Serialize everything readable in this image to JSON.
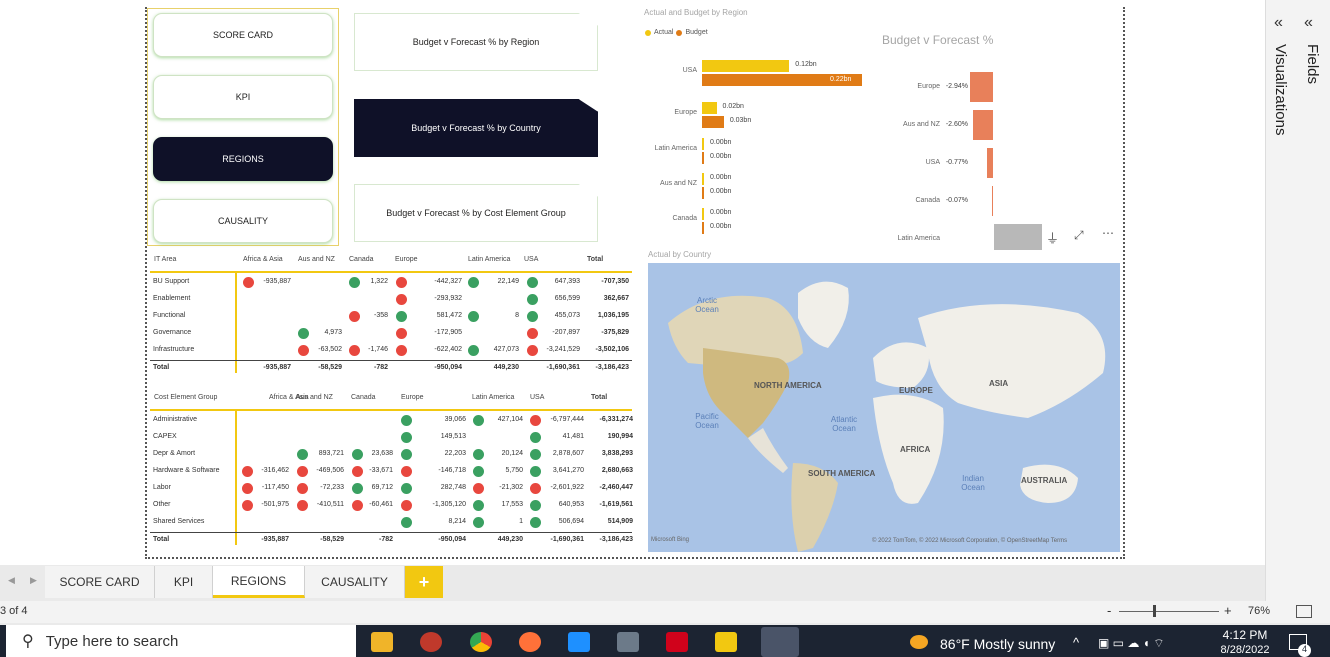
{
  "nav": {
    "buttons": [
      "SCORE CARD",
      "KPI",
      "REGIONS",
      "CAUSALITY"
    ],
    "active": "REGIONS"
  },
  "pages": {
    "buttons": [
      "Budget v Forecast % by Region",
      "Budget v Forecast % by Country",
      "Budget v Forecast % by Cost Element Group"
    ]
  },
  "bar_chart": {
    "title": "Actual and Budget by Region",
    "legend": [
      "Actual",
      "Budget"
    ],
    "colors": {
      "actual": "#f2c811",
      "budget": "#e07b16"
    }
  },
  "pct_chart": {
    "title": "Budget v Forecast %",
    "color": "#e8805a"
  },
  "map": {
    "title": "Actual by Country",
    "labels": {
      "arctic": "Arctic Ocean",
      "north_america": "NORTH AMERICA",
      "europe": "EUROPE",
      "asia": "ASIA",
      "pacific": "Pacific Ocean",
      "atlantic": "Atlantic Ocean",
      "africa": "AFRICA",
      "south_america": "SOUTH AMERICA",
      "indian": "Indian Ocean",
      "australia": "AUSTRALIA"
    },
    "bing": "Microsoft Bing",
    "credits": "© 2022 TomTom, © 2022 Microsoft Corporation, © OpenStreetMap  Terms"
  },
  "chart_data": [
    {
      "type": "bar",
      "title": "Actual and Budget by Region",
      "categories": [
        "USA",
        "Europe",
        "Latin America",
        "Aus and NZ",
        "Canada"
      ],
      "series": [
        {
          "name": "Actual",
          "values": [
            0.12,
            0.02,
            0.0,
            0.0,
            0.0
          ],
          "labels": [
            "0.12bn",
            "0.02bn",
            "0.00bn",
            "0.00bn",
            "0.00bn"
          ]
        },
        {
          "name": "Budget",
          "values": [
            0.22,
            0.03,
            0.0,
            0.0,
            0.0
          ],
          "labels": [
            "0.22bn",
            "0.03bn",
            "0.00bn",
            "0.00bn",
            "0.00bn"
          ]
        }
      ],
      "legend": "top-left"
    },
    {
      "type": "bar",
      "title": "Budget v Forecast %",
      "categories": [
        "Europe",
        "Aus and NZ",
        "USA",
        "Canada",
        "Latin America"
      ],
      "values": [
        -2.94,
        -2.6,
        -0.77,
        -0.07,
        0
      ],
      "labels": [
        "-2.94%",
        "-2.60%",
        "-0.77%",
        "-0.07%",
        ""
      ]
    },
    {
      "type": "table",
      "title": "IT Area",
      "columns": [
        "IT Area",
        "Africa & Asia",
        "Aus and NZ",
        "Canada",
        "Europe",
        "Latin America",
        "USA",
        "Total"
      ],
      "rows": [
        [
          "BU Support",
          "-935,887",
          "",
          "1,322",
          "-442,327",
          "22,149",
          "647,393",
          "-707,350"
        ],
        [
          "Enablement",
          "",
          "",
          "",
          "-293,932",
          "",
          "656,599",
          "362,667"
        ],
        [
          "Functional",
          "",
          "",
          "-358",
          "581,472",
          "8",
          "455,073",
          "1,036,195"
        ],
        [
          "Governance",
          "",
          "4,973",
          "",
          "-172,905",
          "",
          "-207,897",
          "-375,829"
        ],
        [
          "Infrastructure",
          "",
          "-63,502",
          "-1,746",
          "-622,402",
          "427,073",
          "-3,241,529",
          "-3,502,106"
        ],
        [
          "Total",
          "-935,887",
          "-58,529",
          "-782",
          "-950,094",
          "449,230",
          "-1,690,361",
          "-3,186,423"
        ]
      ]
    },
    {
      "type": "table",
      "title": "Cost Element Group",
      "columns": [
        "Cost Element Group",
        "Africa & Asia",
        "Aus and NZ",
        "Canada",
        "Europe",
        "Latin America",
        "USA",
        "Total"
      ],
      "rows": [
        [
          "Administrative",
          "",
          "",
          "",
          "39,066",
          "427,104",
          "-6,797,444",
          "-6,331,274"
        ],
        [
          "CAPEX",
          "",
          "",
          "",
          "149,513",
          "",
          "41,481",
          "190,994"
        ],
        [
          "Depr & Amort",
          "",
          "893,721",
          "23,638",
          "22,203",
          "20,124",
          "2,878,607",
          "3,838,293"
        ],
        [
          "Hardware & Software",
          "-316,462",
          "-469,506",
          "-33,671",
          "-146,718",
          "5,750",
          "3,641,270",
          "2,680,663"
        ],
        [
          "Labor",
          "-117,450",
          "-72,233",
          "69,712",
          "282,748",
          "-21,302",
          "-2,601,922",
          "-2,460,447"
        ],
        [
          "Other",
          "-501,975",
          "-410,511",
          "-60,461",
          "-1,305,120",
          "17,553",
          "640,953",
          "-1,619,561"
        ],
        [
          "Shared Services",
          "",
          "",
          "",
          "8,214",
          "1",
          "506,694",
          "514,909"
        ],
        [
          "Total",
          "-935,887",
          "-58,529",
          "-782",
          "-950,094",
          "449,230",
          "-1,690,361",
          "-3,186,423"
        ]
      ]
    }
  ],
  "it_table": {
    "headers": [
      "IT Area",
      "Africa & Asia",
      "Aus and NZ",
      "Canada",
      "Europe",
      "Latin America",
      "USA",
      "Total"
    ],
    "rows": [
      {
        "name": "BU Support",
        "cells": [
          "-935,887",
          "",
          "1,322",
          "-442,327",
          "22,149",
          "647,393",
          "-707,350"
        ],
        "dots": [
          "r",
          "",
          "g",
          "r",
          "g",
          "g",
          ""
        ]
      },
      {
        "name": "Enablement",
        "cells": [
          "",
          "",
          "",
          "-293,932",
          "",
          "656,599",
          "362,667"
        ],
        "dots": [
          "",
          "",
          "",
          "r",
          "",
          "g",
          ""
        ]
      },
      {
        "name": "Functional",
        "cells": [
          "",
          "",
          "-358",
          "581,472",
          "8",
          "455,073",
          "1,036,195"
        ],
        "dots": [
          "",
          "",
          "r",
          "g",
          "g",
          "g",
          ""
        ]
      },
      {
        "name": "Governance",
        "cells": [
          "",
          "4,973",
          "",
          "-172,905",
          "",
          "-207,897",
          "-375,829"
        ],
        "dots": [
          "",
          "g",
          "",
          "r",
          "",
          "r",
          ""
        ]
      },
      {
        "name": "Infrastructure",
        "cells": [
          "",
          "-63,502",
          "-1,746",
          "-622,402",
          "427,073",
          "-3,241,529",
          "-3,502,106"
        ],
        "dots": [
          "",
          "r",
          "r",
          "r",
          "g",
          "r",
          ""
        ]
      },
      {
        "name": "Total",
        "cells": [
          "-935,887",
          "-58,529",
          "-782",
          "-950,094",
          "449,230",
          "-1,690,361",
          "-3,186,423"
        ],
        "dots": [
          "",
          "",
          "",
          "",
          "",
          "",
          ""
        ]
      }
    ]
  },
  "ce_table": {
    "headers": [
      "Cost Element Group",
      "Africa & Asia",
      "Aus and NZ",
      "Canada",
      "Europe",
      "Latin America",
      "USA",
      "Total"
    ],
    "rows": [
      {
        "name": "Administrative",
        "cells": [
          "",
          "",
          "",
          "39,066",
          "427,104",
          "-6,797,444",
          "-6,331,274"
        ],
        "dots": [
          "",
          "",
          "",
          "g",
          "g",
          "r",
          ""
        ]
      },
      {
        "name": "CAPEX",
        "cells": [
          "",
          "",
          "",
          "149,513",
          "",
          "41,481",
          "190,994"
        ],
        "dots": [
          "",
          "",
          "",
          "g",
          "",
          "g",
          ""
        ]
      },
      {
        "name": "Depr & Amort",
        "cells": [
          "",
          "893,721",
          "23,638",
          "22,203",
          "20,124",
          "2,878,607",
          "3,838,293"
        ],
        "dots": [
          "",
          "g",
          "g",
          "g",
          "g",
          "g",
          ""
        ]
      },
      {
        "name": "Hardware & Software",
        "cells": [
          "-316,462",
          "-469,506",
          "-33,671",
          "-146,718",
          "5,750",
          "3,641,270",
          "2,680,663"
        ],
        "dots": [
          "r",
          "r",
          "r",
          "r",
          "g",
          "g",
          ""
        ]
      },
      {
        "name": "Labor",
        "cells": [
          "-117,450",
          "-72,233",
          "69,712",
          "282,748",
          "-21,302",
          "-2,601,922",
          "-2,460,447"
        ],
        "dots": [
          "r",
          "r",
          "g",
          "g",
          "r",
          "r",
          ""
        ]
      },
      {
        "name": "Other",
        "cells": [
          "-501,975",
          "-410,511",
          "-60,461",
          "-1,305,120",
          "17,553",
          "640,953",
          "-1,619,561"
        ],
        "dots": [
          "r",
          "r",
          "r",
          "r",
          "g",
          "g",
          ""
        ]
      },
      {
        "name": "Shared Services",
        "cells": [
          "",
          "",
          "",
          "8,214",
          "1",
          "506,694",
          "514,909"
        ],
        "dots": [
          "",
          "",
          "",
          "g",
          "g",
          "g",
          ""
        ]
      },
      {
        "name": "Total",
        "cells": [
          "-935,887",
          "-58,529",
          "-782",
          "-950,094",
          "449,230",
          "-1,690,361",
          "-3,186,423"
        ],
        "dots": [
          "",
          "",
          "",
          "",
          "",
          "",
          ""
        ]
      }
    ]
  },
  "tabs": [
    "SCORE CARD",
    "KPI",
    "REGIONS",
    "CAUSALITY"
  ],
  "add_tab": "+",
  "status": {
    "page": "3 of 4",
    "zoom": "76%"
  },
  "rightpane": {
    "visualizations": "Visualizations",
    "fields": "Fields"
  },
  "taskbar": {
    "search_placeholder": "Type here to search",
    "weather": "86°F  Mostly sunny",
    "time": "4:12 PM",
    "date": "8/28/2022",
    "notifications": "4"
  }
}
